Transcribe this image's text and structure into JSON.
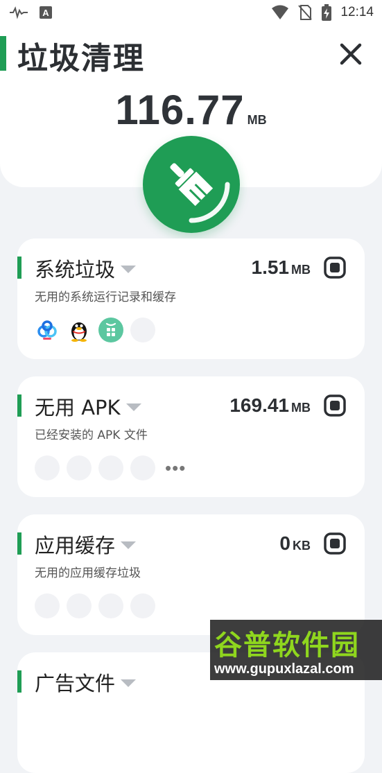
{
  "status_bar": {
    "time": "12:14"
  },
  "header": {
    "title": "垃圾清理",
    "total_size": {
      "value": "116.77",
      "unit": "MB"
    }
  },
  "cards": [
    {
      "title": "系统垃圾",
      "size": "1.51",
      "unit": "MB",
      "description": "无用的系统运行记录和缓存",
      "icons": [
        "baidu-cloud-icon",
        "qq-penguin-icon",
        "green-app-icon"
      ]
    },
    {
      "title": "无用 APK",
      "size": "169.41",
      "unit": "MB",
      "description": "已经安装的 APK 文件",
      "more": "•••"
    },
    {
      "title": "应用缓存",
      "size": "0",
      "unit": "KB",
      "description": "无用的应用缓存垃圾"
    },
    {
      "title": "广告文件"
    }
  ],
  "watermark": {
    "title": "谷普软件园",
    "url": "www.gupuxlazal.com"
  },
  "colors": {
    "accent": "#1f9d55",
    "background": "#f1f3f6",
    "text": "#2c2f33"
  }
}
